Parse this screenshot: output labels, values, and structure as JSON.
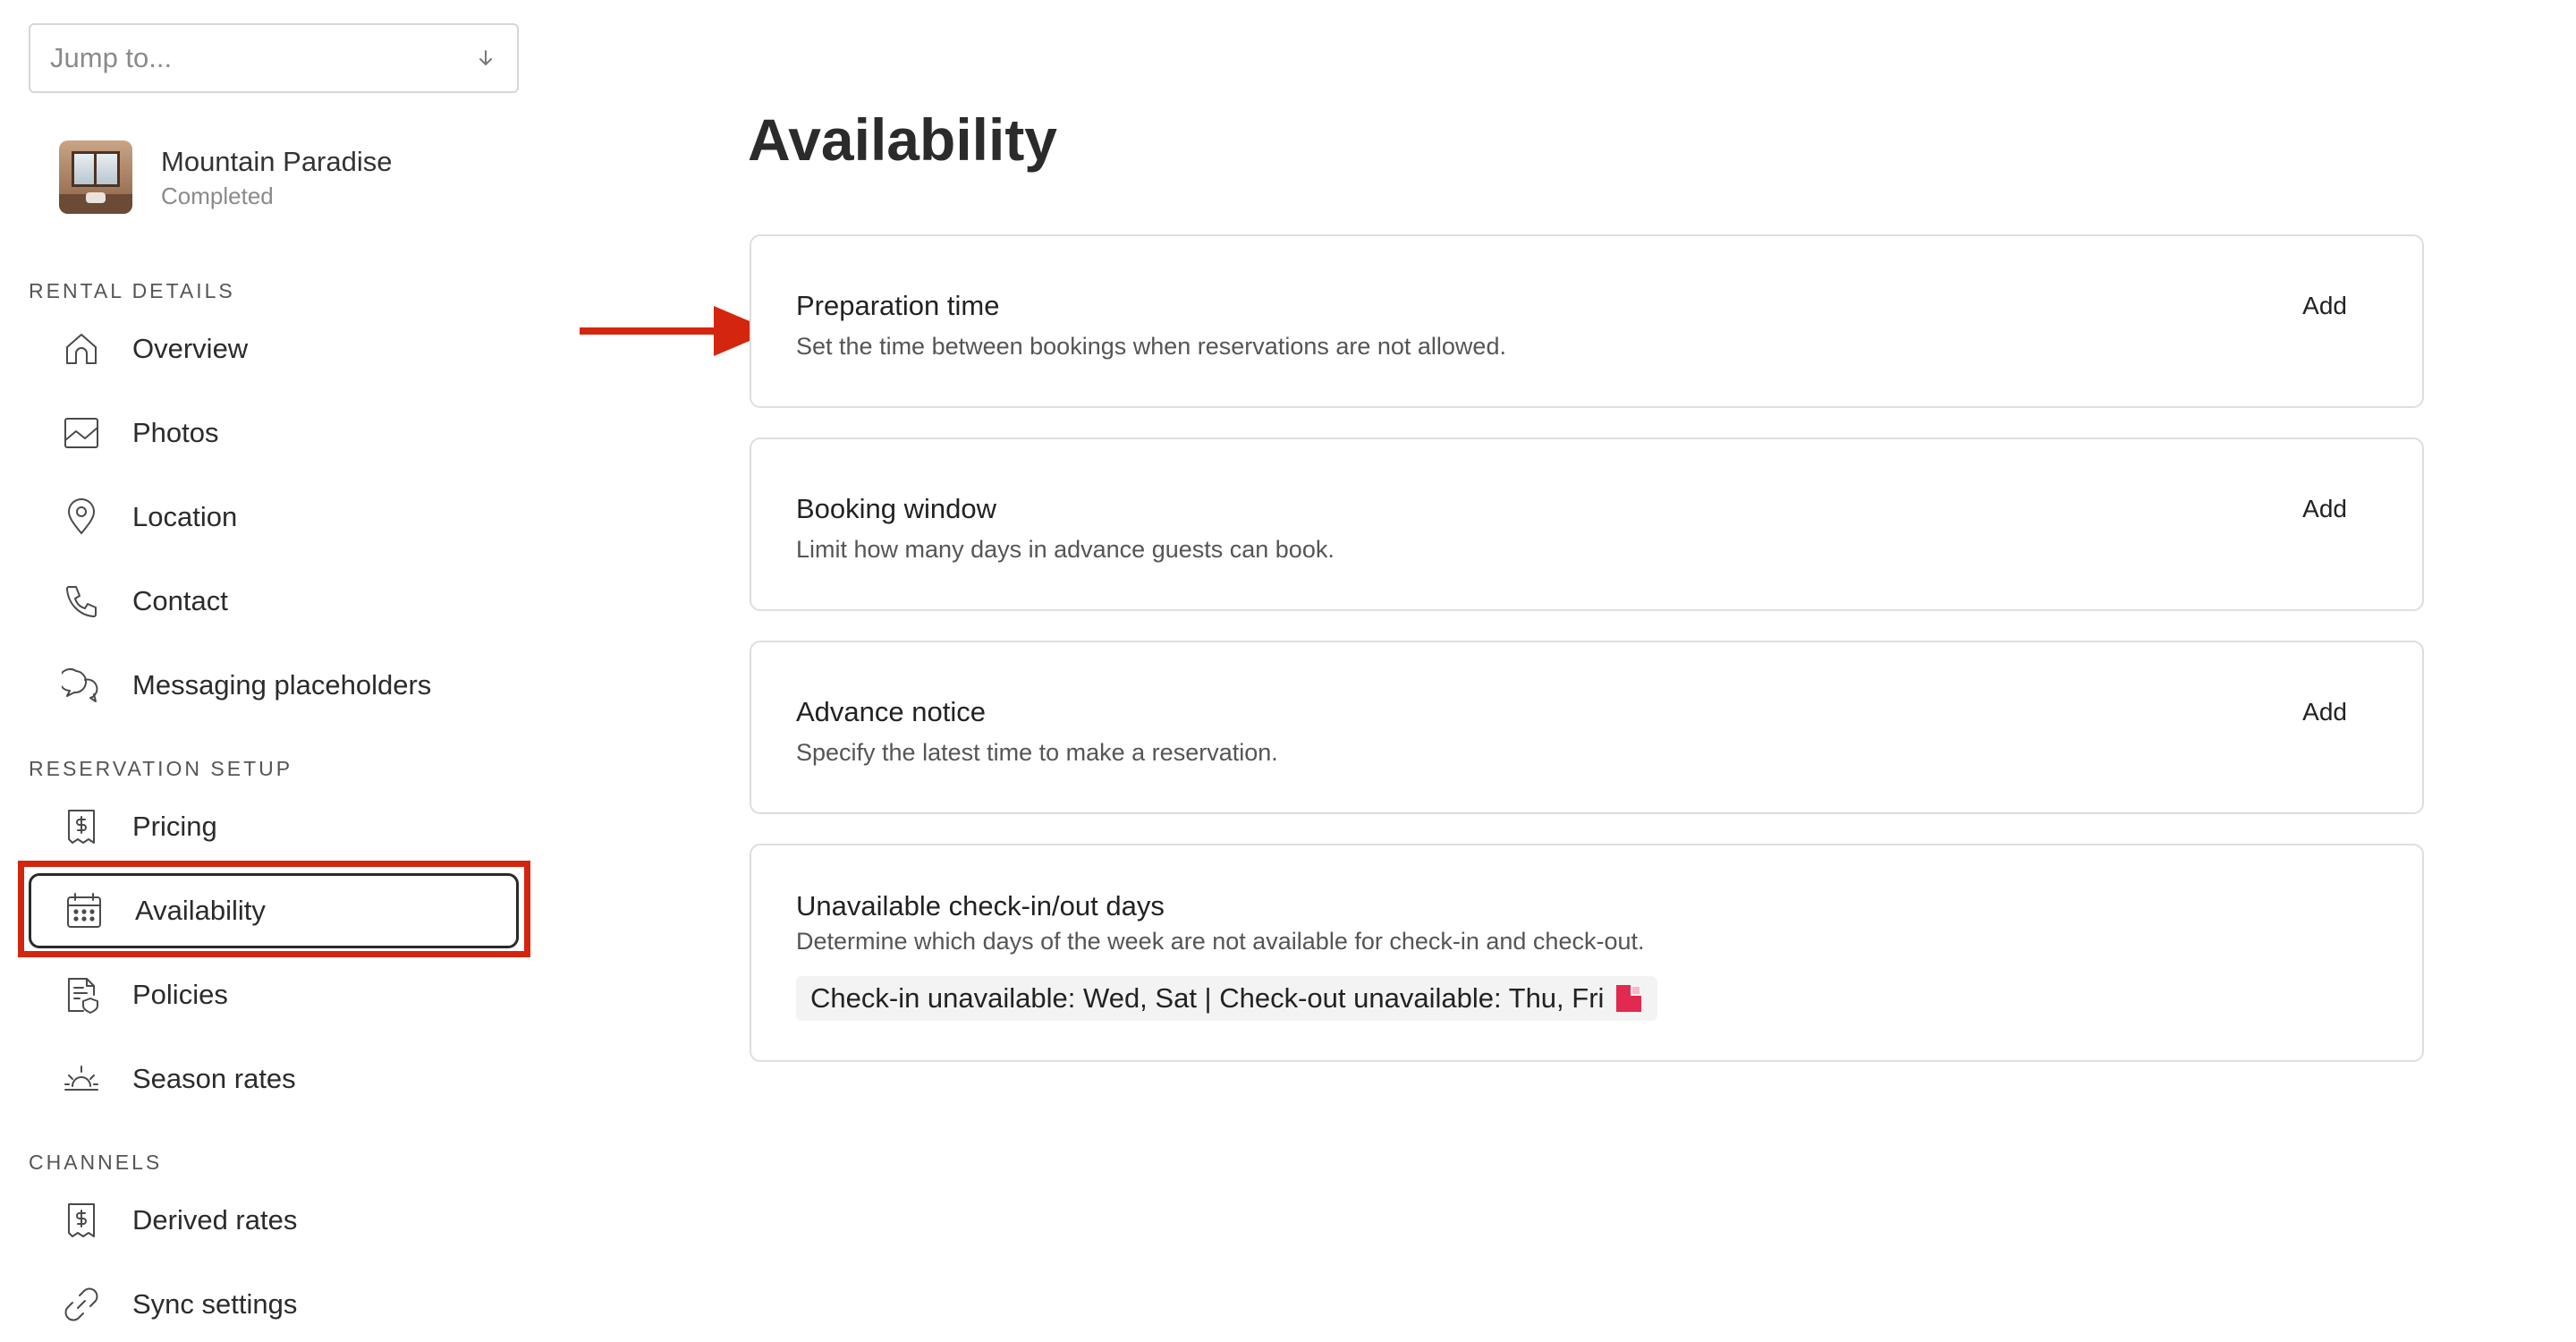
{
  "sidebar": {
    "jump_placeholder": "Jump to...",
    "property": {
      "name": "Mountain Paradise",
      "status": "Completed"
    },
    "sections": {
      "rental_details": "RENTAL DETAILS",
      "reservation_setup": "RESERVATION SETUP",
      "channels": "CHANNELS"
    },
    "items": {
      "overview": "Overview",
      "photos": "Photos",
      "location": "Location",
      "contact": "Contact",
      "messaging": "Messaging placeholders",
      "pricing": "Pricing",
      "availability": "Availability",
      "policies": "Policies",
      "season_rates": "Season rates",
      "derived_rates": "Derived rates",
      "sync_settings": "Sync settings"
    },
    "active_item": "Availability"
  },
  "main": {
    "title": "Availability",
    "cards": {
      "prep": {
        "title": "Preparation time",
        "desc": "Set the time between bookings when reservations are not allowed.",
        "action": "Add"
      },
      "booking": {
        "title": "Booking window",
        "desc": "Limit how many days in advance guests can book.",
        "action": "Add"
      },
      "notice": {
        "title": "Advance notice",
        "desc": "Specify the latest time to make a reservation.",
        "action": "Add"
      },
      "checkin": {
        "title": "Unavailable check-in/out days",
        "desc": "Determine which days of the week are not available for check-in and check-out.",
        "value": "Check-in unavailable: Wed, Sat | Check-out unavailable: Thu, Fri"
      }
    }
  },
  "colors": {
    "annotation_red": "#d4250e",
    "flag_red": "#e2294f"
  },
  "icons": {
    "jump_arrow": "arrow-down-icon",
    "overview": "home-icon",
    "photos": "image-icon",
    "location": "map-pin-icon",
    "contact": "phone-icon",
    "messaging": "chat-bubbles-icon",
    "pricing": "dollar-document-icon",
    "availability": "calendar-icon",
    "policies": "document-shield-icon",
    "season_rates": "sun-icon",
    "derived_rates": "dollar-document-icon",
    "sync_settings": "link-icon"
  }
}
